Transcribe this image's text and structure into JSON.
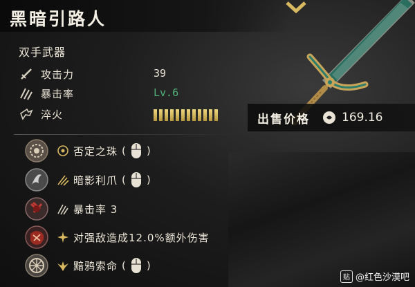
{
  "item": {
    "name": "黑暗引路人",
    "type": "双手武器"
  },
  "stats": [
    {
      "label": "攻击力",
      "value": "39",
      "icon": "sword-icon"
    },
    {
      "label": "暴击率",
      "value": "Lv.6",
      "icon": "crit-claw-icon",
      "color": "#4fb37a"
    },
    {
      "label": "淬火",
      "value": "",
      "icon": "quench-icon",
      "bars": 12
    }
  ],
  "sell": {
    "label": "出售价格",
    "value": "169.16",
    "icon": "currency-coin-icon"
  },
  "perks": [
    {
      "text": "否定之珠",
      "icon": "orb-ring-icon",
      "medal": "negation-orb-medal",
      "has_mouse": true,
      "paren_open": "(",
      "paren_close": ")"
    },
    {
      "text": "暗影利爪",
      "icon": "shadow-claw-icon",
      "medal": "shadow-claw-medal",
      "has_mouse": true,
      "paren_open": "(",
      "paren_close": ")"
    },
    {
      "text": "暴击率 3",
      "icon": "crit-claw-icon",
      "medal": "crit-medal",
      "has_mouse": false
    },
    {
      "text": "对强敌造成12.0%额外伤害",
      "icon": "burst-icon",
      "medal": "damage-medal",
      "has_mouse": false
    },
    {
      "text": "黯鸦索命",
      "icon": "raven-icon",
      "medal": "raven-medal",
      "has_mouse": true,
      "paren_open": "(",
      "paren_close": ")"
    }
  ],
  "watermark": {
    "badge": "贴",
    "text": "@红色沙漠吧"
  },
  "colors": {
    "accent_gold": "#d8b860",
    "crit_green": "#4fb37a",
    "text": "#ece6d8"
  }
}
